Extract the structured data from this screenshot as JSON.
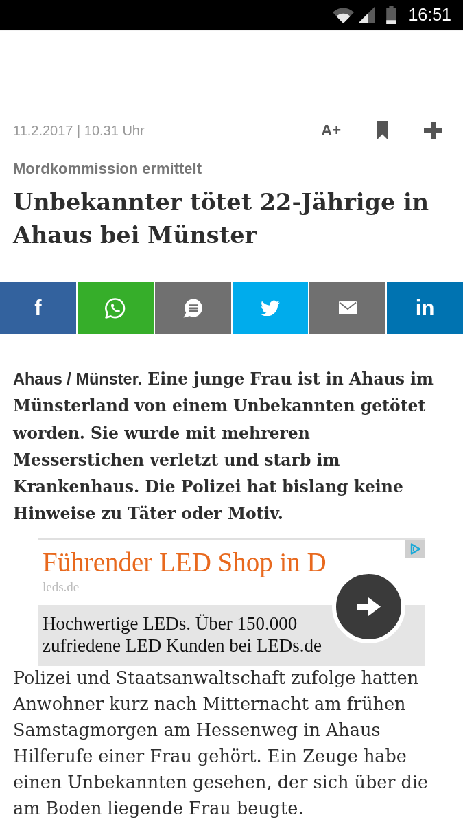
{
  "status_bar": {
    "time": "16:51"
  },
  "article": {
    "date": "11.2.2017 | 10.31 Uhr",
    "font_size_label": "A+",
    "kicker": "Mordkommission ermittelt",
    "headline": "Unbekannter tötet 22-Jährige in Ahaus bei Münster"
  },
  "share_buttons": [
    {
      "kind": "letters",
      "label": "f",
      "color": "#33629e"
    },
    {
      "kind": "phone",
      "color": "#36ae2a"
    },
    {
      "kind": "chat",
      "color": "#707070"
    },
    {
      "kind": "bird",
      "color": "#00acec"
    },
    {
      "kind": "mail",
      "color": "#707070"
    },
    {
      "kind": "letters",
      "label": "in",
      "color": "#0073b1"
    }
  ],
  "lead": {
    "dateline": "Ahaus / Münster.",
    "text": "Eine junge Frau ist in Ahaus im Münsterland von einem Unbekannten getötet worden. Sie wurde mit mehreren Messerstichen verletzt und starb im Krankenhaus. Die Polizei hat bislang keine Hinweise zu Täter oder Motiv."
  },
  "ad": {
    "title": "Führender LED Shop in D",
    "domain": "leds.de",
    "description": "Hochwertige LEDs. Über 150.000 zufriedene LED Kunden bei LEDs.de"
  },
  "body": [
    "Polizei und Staatsanwaltschaft zufolge hatten Anwohner kurz nach Mitternacht am frühen Samstagmorgen am Hessenweg in Ahaus Hilferufe einer Frau gehört. Ein Zeuge habe einen Unbekannten gesehen, der sich über die am Boden liegende Frau beugte."
  ]
}
